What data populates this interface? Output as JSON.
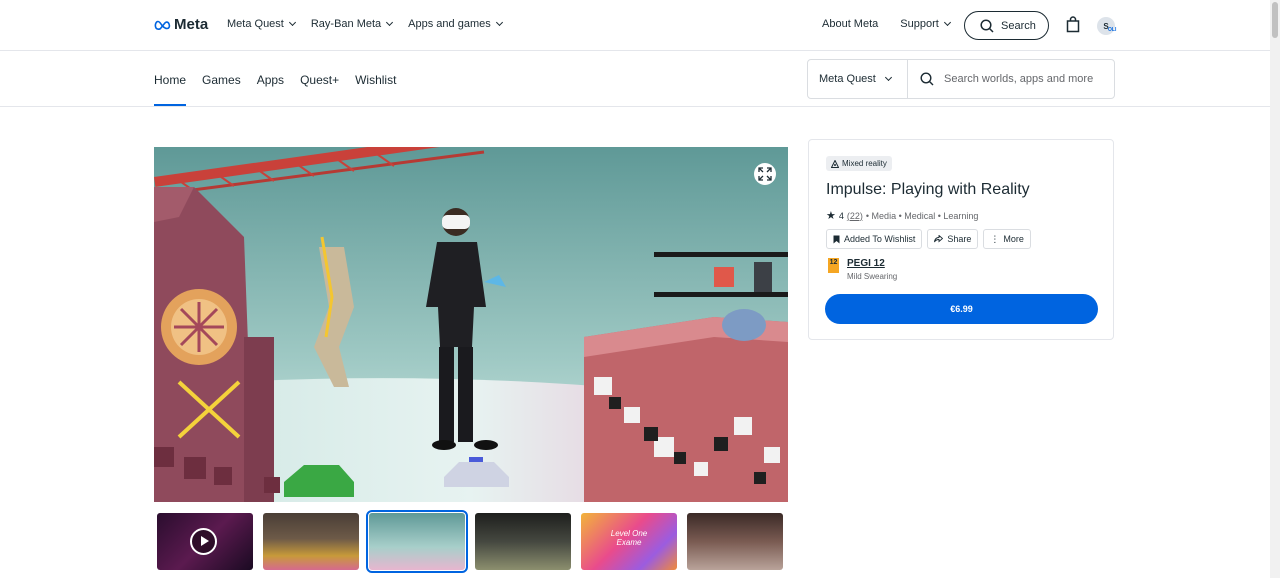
{
  "brand": {
    "name": "Meta",
    "accent": "#0064e0"
  },
  "topnav": {
    "left": [
      {
        "label": "Meta Quest"
      },
      {
        "label": "Ray-Ban Meta"
      },
      {
        "label": "Apps and games"
      }
    ],
    "about": "About Meta",
    "support": "Support",
    "search": "Search",
    "avatar_initial": "S",
    "avatar_badge": "OLI"
  },
  "storenav": {
    "tabs": [
      "Home",
      "Games",
      "Apps",
      "Quest+",
      "Wishlist"
    ],
    "active_tab": "Home",
    "platform": "Meta Quest",
    "search_placeholder": "Search worlds, apps and more"
  },
  "media": {
    "hero_icon": "expand-icon",
    "thumbnails": [
      {
        "kind": "video",
        "icon": "play-icon"
      },
      {
        "kind": "image"
      },
      {
        "kind": "image",
        "selected": true
      },
      {
        "kind": "image"
      },
      {
        "kind": "image",
        "text": "Level One Exame"
      },
      {
        "kind": "image"
      }
    ]
  },
  "product": {
    "badge": "Mixed reality",
    "title": "Impulse: Playing with Reality",
    "rating": "4",
    "rating_count": "(22)",
    "categories": "• Media • Medical • Learning",
    "wishlist": "Added To Wishlist",
    "share": "Share",
    "more": "More",
    "pegi_number": "12",
    "pegi_label": "PEGI 12",
    "pegi_desc": "Mild Swearing",
    "price": "€6.99"
  }
}
